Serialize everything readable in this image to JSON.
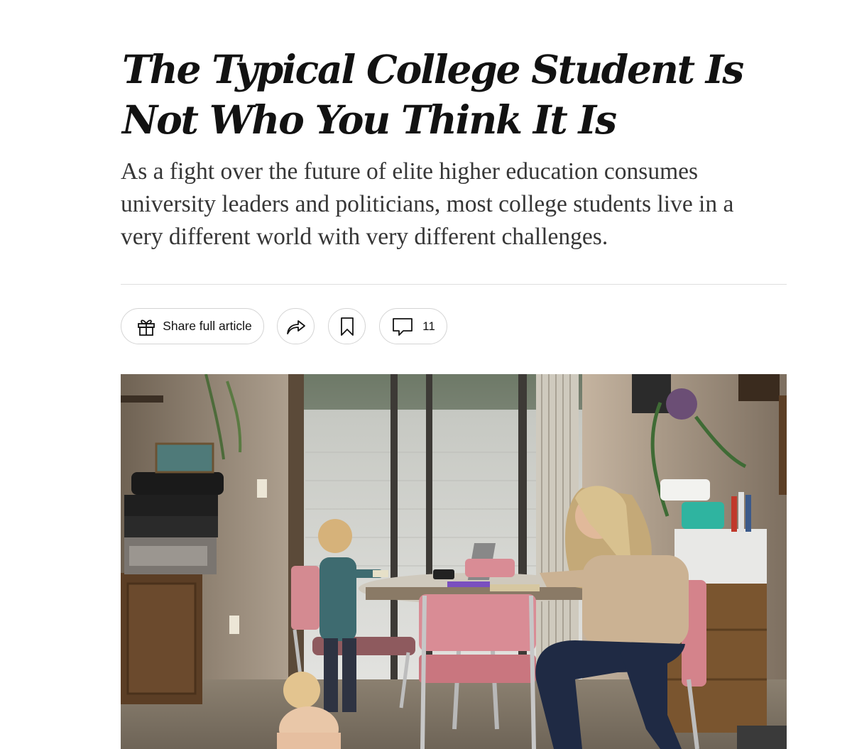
{
  "article": {
    "headline": "The Typical College Student Is Not Who You Think It Is",
    "summary": "As a fight over the future of elite higher education consumes university leaders and politicians, most college students live in a very different world with very different challenges."
  },
  "toolbar": {
    "share_full_label": "Share full article",
    "share_icon": "share-arrow-icon",
    "save_icon": "bookmark-icon",
    "comment_icon": "speech-bubble-icon",
    "comment_count": "11"
  },
  "colors": {
    "headline": "#121212",
    "summary": "#363636",
    "divider": "#dfdfdf",
    "pill_border": "#d4d4d4"
  }
}
